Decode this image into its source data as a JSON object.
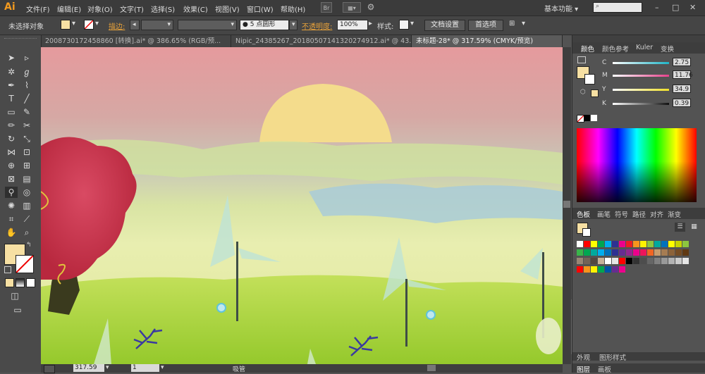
{
  "menubar": {
    "logo": "Ai",
    "menus": [
      "文件(F)",
      "编辑(E)",
      "对象(O)",
      "文字(T)",
      "选择(S)",
      "效果(C)",
      "视图(V)",
      "窗口(W)",
      "帮助(H)"
    ],
    "workspace": "基本功能",
    "window_controls": [
      "–",
      "□",
      "✕"
    ]
  },
  "control_bar": {
    "selection_status": "未选择对象",
    "stroke_label": "描边:",
    "brush_value": "5 点圆形",
    "opacity_label": "不透明度:",
    "opacity_value": "100%",
    "style_label": "样式:",
    "doc_settings_button": "文档设置",
    "preferences_button": "首选项",
    "fill_color": "#f7e0a3"
  },
  "tabs": [
    {
      "label": "2008730172458860 [转换].ai* @ 386.65% (RGB/预..."
    },
    {
      "label": "Nipic_24385267_20180507141320274912.ai* @ 43..."
    },
    {
      "label": "未标题-28* @ 317.59% (CMYK/预览)"
    }
  ],
  "status_bar": {
    "zoom": "317.59",
    "page": "1",
    "tool_name": "吸管"
  },
  "color_panel": {
    "tabs": [
      "颜色",
      "颜色参考",
      "Kuler",
      "变换"
    ],
    "sliders": [
      {
        "label": "C",
        "value": "2.75",
        "color": "#1fb5c8"
      },
      {
        "label": "M",
        "value": "11.76",
        "color": "#e6418b"
      },
      {
        "label": "Y",
        "value": "34.9",
        "color": "#f0e02a"
      },
      {
        "label": "K",
        "value": "0.39",
        "color": "#222222"
      }
    ],
    "fill_color": "#f7e0a3"
  },
  "swatches_panel": {
    "tabs": [
      "色板",
      "画笔",
      "符号",
      "路径",
      "对齐",
      "渐变"
    ],
    "colors": [
      "#ffffff",
      "#ff0000",
      "#ffff00",
      "#00a651",
      "#00aeef",
      "#2e3192",
      "#ec008c",
      "#ed1c24",
      "#f7941d",
      "#fff200",
      "#8dc63f",
      "#00a99d",
      "#0072bc",
      "#ffff00",
      "#c8d400",
      "#8dc63f",
      "#39b54a",
      "#00a651",
      "#00a99d",
      "#00aeef",
      "#0072bc",
      "#2e3192",
      "#662d91",
      "#92278f",
      "#ec008c",
      "#ed145b",
      "#f26522",
      "#c69c6d",
      "#a67c52",
      "#8c6239",
      "#754c24",
      "#603913",
      "#998675",
      "#736357",
      "#534741",
      "#c7b299",
      "#ffffff",
      "#e6e6e6",
      "#ff0000",
      "#000000",
      "#333333",
      "#4d4d4d",
      "#666666",
      "#808080",
      "#999999",
      "#b3b3b3",
      "#cccccc",
      "#e6e6e6",
      "#ff0000",
      "#f7941d",
      "#fff200",
      "#00a651",
      "#0054a6",
      "#662d91",
      "#ec008c"
    ]
  },
  "bottom_panels": {
    "tabs_a": [
      "外观",
      "图形样式"
    ],
    "tabs_b": [
      "图层",
      "画板"
    ]
  }
}
